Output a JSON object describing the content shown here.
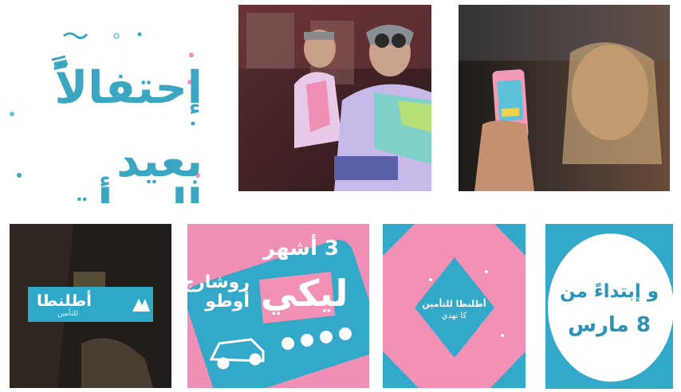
{
  "tiles": {
    "celebration": {
      "line1": "إحتفالاً",
      "line2": "بعيد المرأة"
    },
    "logo": {
      "brand": "أطلنطا",
      "sub": "للتأمين"
    },
    "offer": {
      "months": "3 أشهر",
      "for_you": "ليكي",
      "line_a": "روشارج",
      "line_b": "أوطو"
    },
    "diamond": {
      "line1": "أطلنطا للتأمين",
      "line2": "كا تهدي"
    },
    "date": {
      "line1": "و إبتداءً من",
      "line2": "8 مارس"
    }
  },
  "colors": {
    "teal": "#34a8c8",
    "pink": "#f08fb5",
    "white": "#ffffff"
  }
}
